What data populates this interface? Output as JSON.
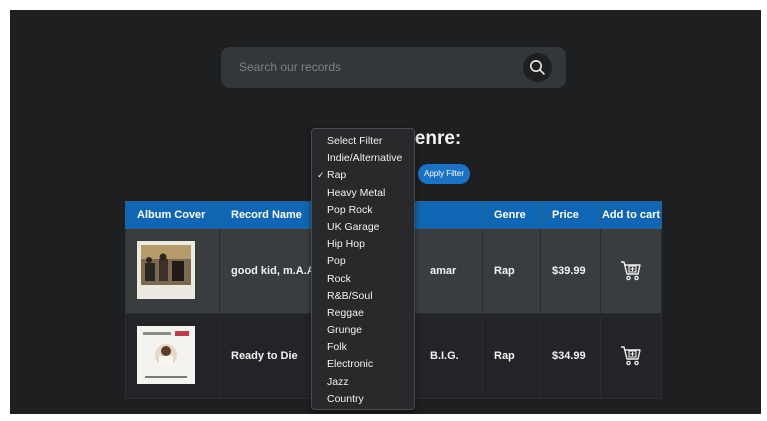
{
  "search": {
    "placeholder": "Search our records",
    "icon": "search-icon"
  },
  "filter": {
    "heading": "enre:",
    "apply_label": "Apply Filter",
    "selected": "Rap",
    "options": [
      {
        "label": "Select Filter",
        "checked": ""
      },
      {
        "label": "Indie/Alternative",
        "checked": ""
      },
      {
        "label": "Rap",
        "checked": "✓"
      },
      {
        "label": "Heavy Metal",
        "checked": ""
      },
      {
        "label": "Pop Rock",
        "checked": ""
      },
      {
        "label": "UK Garage",
        "checked": ""
      },
      {
        "label": "Hip Hop",
        "checked": ""
      },
      {
        "label": "Pop",
        "checked": ""
      },
      {
        "label": "Rock",
        "checked": ""
      },
      {
        "label": "R&B/Soul",
        "checked": ""
      },
      {
        "label": "Reggae",
        "checked": ""
      },
      {
        "label": "Grunge",
        "checked": ""
      },
      {
        "label": "Folk",
        "checked": ""
      },
      {
        "label": "Electronic",
        "checked": ""
      },
      {
        "label": "Jazz",
        "checked": ""
      },
      {
        "label": "Country",
        "checked": ""
      }
    ]
  },
  "table": {
    "headers": [
      "Album Cover",
      "Record Name",
      "",
      "Genre",
      "Price",
      "Add to cart"
    ],
    "rows": [
      {
        "name": "good kid, m.A.A.d",
        "artist": "amar",
        "genre": "Rap",
        "price": "$39.99"
      },
      {
        "name": "Ready to Die",
        "artist": "B.I.G.",
        "genre": "Rap",
        "price": "$34.99"
      }
    ]
  },
  "colors": {
    "header_blue": "#0f66b4",
    "accent": "#1a73c6",
    "background": "#1d1f21"
  }
}
